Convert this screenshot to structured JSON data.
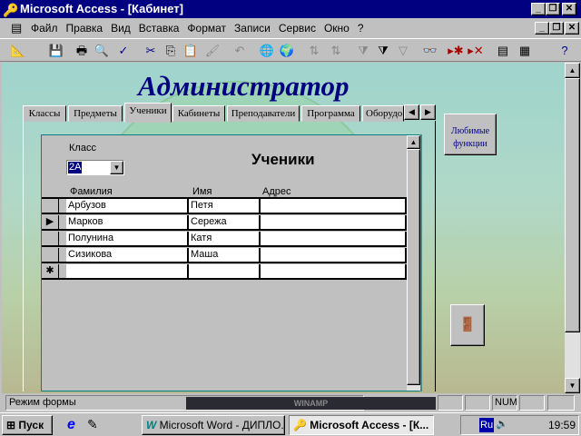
{
  "window": {
    "title": "Microsoft Access - [Кабинет]",
    "minimize": "_",
    "restore": "❐",
    "close": "✕"
  },
  "menu": {
    "items": [
      "Файл",
      "Правка",
      "Вид",
      "Вставка",
      "Формат",
      "Записи",
      "Сервис",
      "Окно",
      "?"
    ]
  },
  "toolbar": {
    "icons": [
      "design-view-icon",
      "save-icon",
      "print-icon",
      "print-preview-icon",
      "spelling-icon",
      "cut-icon",
      "copy-icon",
      "paste-icon",
      "format-painter-icon",
      "undo-icon",
      "hyperlink-icon",
      "web-toolbar-icon",
      "sort-ascending-icon",
      "sort-descending-icon",
      "filter-by-selection-icon",
      "filter-by-form-icon",
      "apply-filter-icon",
      "find-icon",
      "new-record-icon",
      "delete-record-icon",
      "database-window-icon",
      "new-object-icon",
      "help-icon"
    ]
  },
  "form": {
    "header": "Администратор",
    "tabs": [
      "Классы",
      "Предметы",
      "Ученики",
      "Кабинеты",
      "Преподаватели",
      "Программа",
      "Оборудо"
    ],
    "selected_tab": "Ученики",
    "favorites_button": "Любимые функции",
    "subform": {
      "class_label": "Класс",
      "class_value": "2А",
      "title": "Ученики",
      "columns": [
        "Фамилия",
        "Имя",
        "Адрес"
      ],
      "rows": [
        [
          "Арбузов",
          "Петя",
          ""
        ],
        [
          "Марков",
          "Сережа",
          ""
        ],
        [
          "Полунина",
          "Катя",
          ""
        ],
        [
          "Сизикова",
          "Маша",
          ""
        ]
      ],
      "current_row_marker": "▶",
      "new_row_marker": "✱"
    }
  },
  "status": {
    "text": "Режим формы",
    "num": "NUM",
    "winamp": "WINAMP"
  },
  "taskbar": {
    "start": "Пуск",
    "tasks": [
      "Microsoft Word - ДИПЛО...",
      "Microsoft Access - [К..."
    ],
    "lang": "Ru",
    "clock": "19:59"
  }
}
